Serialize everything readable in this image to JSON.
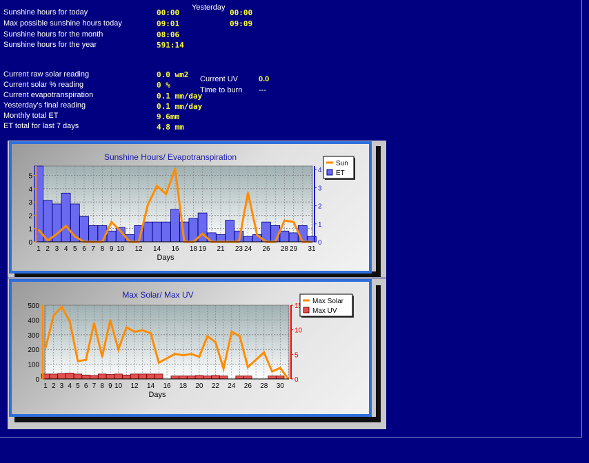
{
  "sunshine": {
    "yesterday_header": "Yesterday",
    "rows": [
      {
        "label": "Sunshine hours for today",
        "value": "00:00",
        "yesterday": "00:00"
      },
      {
        "label": "Max possible sunshine hours today",
        "value": "09:01",
        "yesterday": "09:09"
      },
      {
        "label": "Sunshine hours for the month",
        "value": "08:06"
      },
      {
        "label": "Sunshine hours for the year",
        "value": "591:14"
      }
    ]
  },
  "solar": {
    "rows": [
      {
        "label": "Current raw solar reading",
        "value": "0.0 wm2"
      },
      {
        "label": "Current solar % reading",
        "value": "0 %"
      },
      {
        "label": "Current evapotranspiration",
        "value": "0.1 mm/day"
      },
      {
        "label": "Yesterday's final reading",
        "value": "0.1 mm/day"
      },
      {
        "label": "Monthly total ET",
        "value": "9.6mm"
      },
      {
        "label": "ET total for last 7 days",
        "value": "4.8 mm"
      }
    ],
    "uv": {
      "label": "Current UV",
      "value": "0.0",
      "burn_label": "Time to burn",
      "burn_value": "---"
    }
  },
  "chart_data": [
    {
      "type": "bar",
      "title": "Sunshine Hours/ Evapotranspiration",
      "xlabel": "Days",
      "x_ticks": [
        "1",
        "2",
        "3",
        "4",
        "5",
        "6",
        "7",
        "8",
        "9",
        "10",
        "12",
        "14",
        "16",
        "18",
        "19",
        "21",
        "23",
        "24",
        "26",
        "28",
        "29",
        "31"
      ],
      "x": [
        1,
        2,
        3,
        4,
        5,
        6,
        7,
        8,
        9,
        10,
        11,
        12,
        13,
        14,
        15,
        16,
        17,
        18,
        19,
        20,
        21,
        22,
        23,
        24,
        25,
        26,
        27,
        28,
        29,
        30,
        31
      ],
      "ylim_left": [
        0,
        5.7
      ],
      "ylim_right": [
        0,
        4.2
      ],
      "y_ticks_left": [
        0,
        1,
        2,
        3,
        4,
        5
      ],
      "y_ticks_right": [
        0,
        1,
        2,
        3,
        4
      ],
      "legend": [
        "Sun",
        "ET"
      ],
      "legend_position": "top-right",
      "grid": true,
      "colors": {
        "sun": "#ff8c00",
        "et": "#6a6af0",
        "et_edge": "#000080",
        "left_axis": "#ff8c00",
        "right_axis": "#1a1acc"
      },
      "series": [
        {
          "name": "ET",
          "axis": "right",
          "values": [
            4.2,
            2.3,
            2.1,
            2.7,
            2.1,
            1.4,
            0.9,
            0.9,
            0.6,
            0.8,
            0.4,
            0.9,
            1.1,
            1.1,
            1.1,
            1.8,
            1.1,
            1.3,
            1.6,
            0.5,
            0.4,
            1.2,
            0.6,
            0.3,
            0.4,
            1.1,
            0.9,
            0.6,
            0.5,
            0.9,
            0.3
          ]
        },
        {
          "name": "Sun",
          "axis": "left",
          "values": [
            0.9,
            0.1,
            0.6,
            1.2,
            0.4,
            0,
            0,
            0,
            1.5,
            0.8,
            0,
            0,
            2.8,
            4.2,
            3.6,
            5.5,
            0,
            0,
            0.6,
            0,
            0,
            0,
            0,
            3.7,
            0.5,
            0,
            0,
            1.6,
            1.5,
            0,
            0
          ]
        }
      ]
    },
    {
      "type": "line",
      "title": "Max Solar/ Max UV",
      "xlabel": "Days",
      "x_ticks": [
        "1",
        "2",
        "3",
        "4",
        "5",
        "6",
        "7",
        "8",
        "9",
        "10",
        "12",
        "14",
        "16",
        "18",
        "20",
        "22",
        "24",
        "26",
        "28",
        "30"
      ],
      "x": [
        1,
        2,
        3,
        4,
        5,
        6,
        7,
        8,
        9,
        10,
        11,
        12,
        13,
        14,
        15,
        16,
        17,
        18,
        19,
        20,
        21,
        22,
        23,
        24,
        25,
        26,
        27,
        28,
        29,
        30,
        31
      ],
      "ylim_left": [
        0,
        500
      ],
      "ylim_right": [
        0,
        15
      ],
      "y_ticks_left": [
        0,
        100,
        200,
        300,
        400,
        500
      ],
      "y_ticks_right": [
        0,
        5,
        10,
        15
      ],
      "legend": [
        "Max Solar",
        "Max UV"
      ],
      "legend_position": "top-right",
      "grid": true,
      "colors": {
        "solar": "#ff8c00",
        "uv": "#e05050",
        "uv_edge": "#800000",
        "left_axis": "#ff8c00",
        "right_axis": "#ff0000"
      },
      "series": [
        {
          "name": "Max Solar",
          "axis": "left",
          "values": [
            210,
            430,
            490,
            390,
            120,
            130,
            380,
            150,
            400,
            200,
            350,
            320,
            330,
            310,
            110,
            140,
            170,
            160,
            170,
            150,
            290,
            250,
            70,
            320,
            290,
            80,
            130,
            180,
            50,
            75,
            0
          ]
        },
        {
          "name": "Max UV",
          "axis": "right",
          "values": [
            1,
            1,
            1.1,
            1.2,
            1,
            0.8,
            0.7,
            1,
            0.9,
            1,
            0.8,
            1,
            1,
            1,
            1,
            0,
            0.6,
            0.6,
            0.6,
            0.7,
            0.6,
            0.7,
            0.6,
            0,
            0.6,
            0.6,
            0,
            0,
            0.6,
            0.6,
            0
          ]
        }
      ]
    }
  ]
}
